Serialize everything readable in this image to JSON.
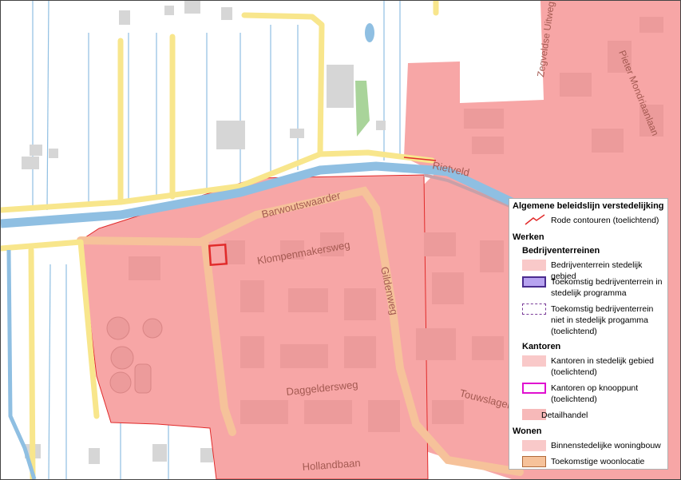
{
  "map": {
    "street_labels": {
      "rietveld": "Rietveld",
      "barwoutswaarder": "Barwoutswaarder",
      "klompenmakersweg": "Klompenmakersweg",
      "gildenweg": "Gildenweg",
      "daggeldersweg": "Daggeldersweg",
      "touwslagerweg": "Touwslagerweg",
      "hollandbaan": "Hollandbaan",
      "zegveldse_uitweg": "Zegveldse Uitweg",
      "piet_mondriaanlaan": "Pieter Mondriaanlaan"
    },
    "colors": {
      "water": "#8fbfe2",
      "main_road": "#f8e68c",
      "urban_area": "#f7a6a6",
      "future_housing": "#f6c29a",
      "building": "#d6d6d6",
      "green": "#a9d49a",
      "contour": "#e12b2b"
    }
  },
  "legend": {
    "title": "Algemene beleidslijn verstedelijking",
    "contour_label": "Rode contouren (toelichtend)",
    "sections": {
      "werken": "Werken",
      "bedrijventerreinen": "Bedrijventerreinen",
      "kantoren": "Kantoren",
      "wonen": "Wonen"
    },
    "items": {
      "bedrijventerrein_stedelijk": "Bedrijventerrein stedelijk gebied",
      "toekomstig_in_programma": "Toekomstig bedrijventerrein in stedelijk programma",
      "toekomstig_niet_in_programma": "Toekomstig bedrijventerrein niet in stedelijk progamma (toelichtend)",
      "kantoren_stedelijk": "Kantoren in stedelijk gebied (toelichtend)",
      "kantoren_knooppunt": "Kantoren op knooppunt (toelichtend)",
      "detailhandel": "Detailhandel",
      "binnenstedelijke_woningbouw": "Binnenstedelijke woningbouw",
      "toekomstige_woonlocatie": "Toekomstige woonlocatie"
    },
    "swatch_colors": {
      "bedrijventerrein_stedelijk": "#f9c9c9",
      "toekomstig_in_programma": "#b7a3f0",
      "toekomstig_in_programma_border": "#4a2c8f",
      "toekomstig_niet_border": "#7a3c98",
      "kantoren_stedelijk": "#f9c9c9",
      "kantoren_knooppunt_border": "#e010d0",
      "detailhandel": "#f7b9b9",
      "binnenstedelijke_woningbouw": "#f9c9c9",
      "toekomstige_woonlocatie": "#f6c29a",
      "toekomstige_woonlocatie_border": "#b06a3a"
    }
  }
}
